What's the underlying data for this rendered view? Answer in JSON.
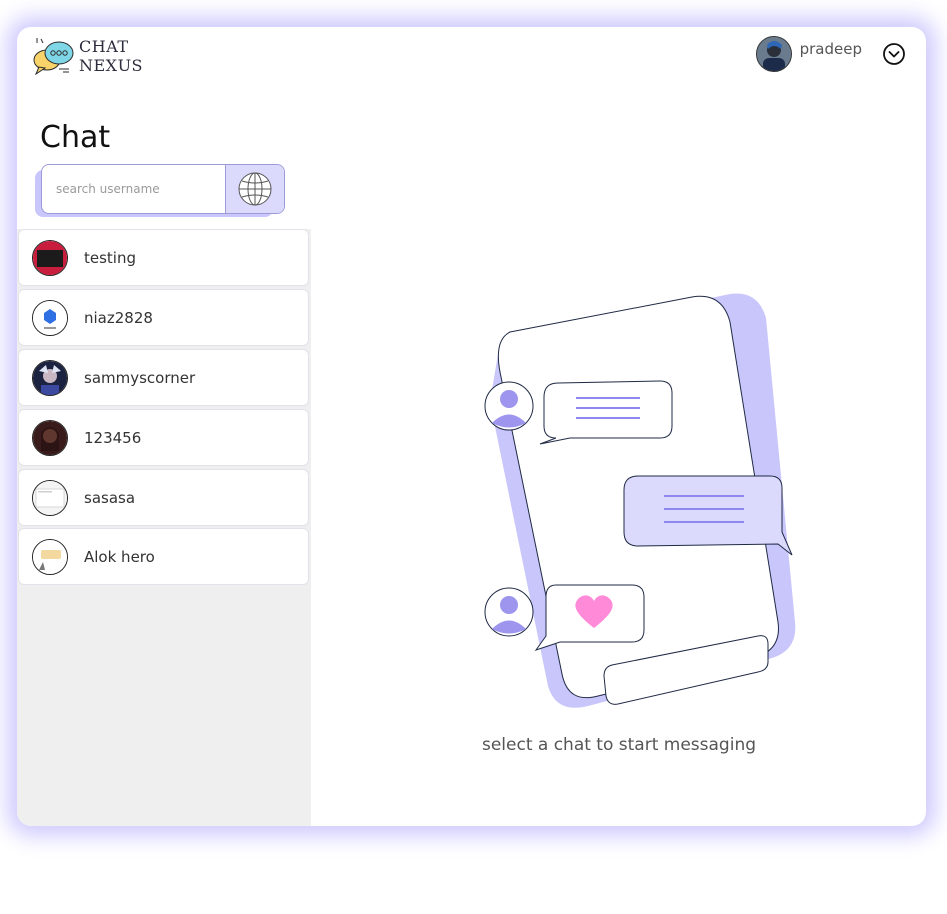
{
  "brand": {
    "line1": "CHAT",
    "line2": "NEXUS",
    "logo_icon": "chat-bubbles-logo"
  },
  "user": {
    "name": "pradeep",
    "dropdown_icon": "chevron-down-circle-icon"
  },
  "sidebar": {
    "heading": "Chat",
    "search": {
      "placeholder": "search username",
      "value": "",
      "button_icon": "globe-icon"
    },
    "contacts": [
      {
        "name": "testing"
      },
      {
        "name": "niaz2828"
      },
      {
        "name": "sammyscorner"
      },
      {
        "name": "123456"
      },
      {
        "name": "sasasa"
      },
      {
        "name": "Alok hero"
      }
    ]
  },
  "main": {
    "empty_message": "select a chat to start messaging",
    "illustration_icon": "chat-phone-illustration"
  },
  "colors": {
    "accent": "#c9c6fc",
    "accent_light": "#dcdafc",
    "bubble_line": "#8f87f0",
    "heart": "#ff8ad8",
    "outline": "#1f2a44"
  }
}
